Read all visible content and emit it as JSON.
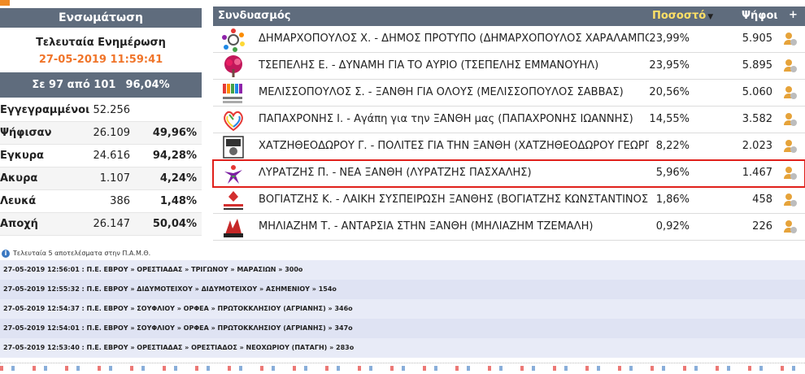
{
  "left_panel": {
    "header": "Ενσωμάτωση",
    "update_title": "Τελευταία Ενημέρωση",
    "update_datetime": "27-05-2019 11:59:41",
    "progress": {
      "label": "Σε 97 από  101",
      "percent": "96,04%",
      "fraction": 0.9604
    },
    "stats": [
      {
        "label": "Εγγεγραμμένοι",
        "value": "52.256",
        "pct": ""
      },
      {
        "label": "Ψήφισαν",
        "value": "26.109",
        "pct": "49,96%"
      },
      {
        "label": "Εγκυρα",
        "value": "24.616",
        "pct": "94,28%"
      },
      {
        "label": "Ακυρα",
        "value": "1.107",
        "pct": "4,24%"
      },
      {
        "label": "Λευκά",
        "value": "386",
        "pct": "1,48%"
      },
      {
        "label": "Αποχή",
        "value": "26.147",
        "pct": "50,04%"
      }
    ]
  },
  "results_table": {
    "headers": {
      "combination": "Συνδυασμός",
      "percent": "Ποσοστό",
      "votes": "Ψήφοι",
      "plus": "+"
    },
    "rows": [
      {
        "name": "ΔΗΜΑΡΧΟΠΟΥΛΟΣ Χ. - ΔΗΜΟΣ ΠΡΟΤΥΠΟ (ΔΗΜΑΡΧΟΠΟΥΛΟΣ ΧΑΡΑΛΑΜΠΟ",
        "pct": "23,99%",
        "votes": "5.905",
        "logo": "circle-people-logo"
      },
      {
        "name": "ΤΣΕΠΕΛΗΣ Ε. - ΔΥΝΑΜΗ ΓΙΑ ΤΟ ΑΥΡΙΟ (ΤΣΕΠΕΛΗΣ ΕΜΜΑΝΟΥΗΛ)",
        "pct": "23,95%",
        "votes": "5.895",
        "logo": "tree-logo"
      },
      {
        "name": "ΜΕΛΙΣΣΟΠΟΥΛΟΣ Σ. - ΞΑΝΘΗ ΓΙΑ ΟΛΟΥΣ (ΜΕΛΙΣΣΟΠΟΥΛΟΣ ΣΑΒΒΑΣ)",
        "pct": "20,56%",
        "votes": "5.060",
        "logo": "colored-bars-logo"
      },
      {
        "name": "ΠΑΠΑΧΡΟΝΗΣ Ι. - Αγάπη για την ΞΑΝΘΗ μας (ΠΑΠΑΧΡΟΝΗΣ ΙΩΑΝΝΗΣ)",
        "pct": "14,55%",
        "votes": "3.582",
        "logo": "rainbow-heart-logo"
      },
      {
        "name": "ΧΑΤΖΗΘΕΟΔΩΡΟΥ Γ. - ΠΟΛΙΤΕΣ ΓΙΑ ΤΗΝ ΞΑΝΘΗ (ΧΑΤΖΗΘΕΟΔΩΡΟΥ ΓΕΩΡΓΙ",
        "pct": "8,22%",
        "votes": "2.023",
        "logo": "crest-logo"
      },
      {
        "name": "ΛΥΡΑΤΖΗΣ Π. - ΝΕΑ ΞΑΝΘΗ (ΛΥΡΑΤΖΗΣ ΠΑΣΧΑΛΗΣ)",
        "pct": "5,96%",
        "votes": "1.467",
        "logo": "star-figure-logo",
        "highlighted": true
      },
      {
        "name": "ΒΟΓΙΑΤΖΗΣ Κ. - ΛΑΪΚΗ ΣΥΣΠΕΙΡΩΣΗ ΞΑΝΘΗΣ (ΒΟΓΙΑΤΖΗΣ ΚΩΝΣΤΑΝΤΙΝΟΣ)",
        "pct": "1,86%",
        "votes": "458",
        "logo": "laiki-logo"
      },
      {
        "name": "ΜΗΛΙΑΖΗΜ Τ. - ΑΝΤΑΡΣΙΑ ΣΤΗΝ ΞΑΝΘΗ (ΜΗΛΙΑΖΗΜ ΤΖΕΜΑΛΗ)",
        "pct": "0,92%",
        "votes": "226",
        "logo": "antarsia-logo"
      }
    ]
  },
  "feed": {
    "title": "Τελευταία 5 αποτελέσματα στην Π.Α.Μ.Θ.",
    "items": [
      "27-05-2019 12:56:01 :    Π.Ε. ΕΒΡΟΥ » ΟΡΕΣΤΙΑΔΑΣ » ΤΡΙΓΩΝΟΥ » ΜΑΡΑΣΙΩΝ » 300ο",
      "27-05-2019 12:55:32 :    Π.Ε. ΕΒΡΟΥ » ΔΙΔΥΜΟΤΕΙΧΟΥ » ΔΙΔΥΜΟΤΕΙΧΟΥ » ΑΣΗΜΕΝΙΟΥ » 154ο",
      "27-05-2019 12:54:37 :    Π.Ε. ΕΒΡΟΥ » ΣΟΥΦΛΙΟΥ » ΟΡΦΕΑ » ΠΡΩΤΟΚΚΛΗΣΙΟΥ (ΑΓΡΙΑΝΗΣ) » 346ο",
      "27-05-2019 12:54:01 :    Π.Ε. ΕΒΡΟΥ » ΣΟΥΦΛΙΟΥ » ΟΡΦΕΑ » ΠΡΩΤΟΚΚΛΗΣΙΟΥ (ΑΓΡΙΑΝΗΣ) » 347ο",
      "27-05-2019 12:53:40 :    Π.Ε. ΕΒΡΟΥ » ΟΡΕΣΤΙΑΔΑΣ » ΟΡΕΣΤΙΑΔΟΣ » ΝΕΟΧΩΡΙΟΥ (ΠΑΤΑΓΗ) » 283ο"
    ]
  },
  "colors": {
    "header_bg": "#5f6c7d",
    "accent_orange": "#f0752a",
    "highlight_red": "#e0201b",
    "sort_yellow": "#ffe066"
  }
}
